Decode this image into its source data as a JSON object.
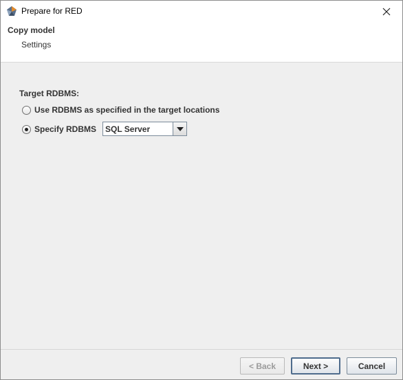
{
  "window": {
    "title": "Prepare for RED",
    "icons": {
      "app": "wherescape-app-icon",
      "close": "close-icon"
    }
  },
  "header": {
    "title": "Copy model",
    "subtitle": "Settings"
  },
  "content": {
    "section_label": "Target RDBMS:",
    "options": [
      {
        "label": "Use RDBMS as specified in the target locations",
        "checked": false
      },
      {
        "label": "Specify RDBMS",
        "checked": true
      }
    ],
    "rdbms_select": {
      "value": "SQL Server"
    }
  },
  "footer": {
    "back_label": "< Back",
    "next_label": "Next >",
    "cancel_label": "Cancel"
  },
  "colors": {
    "panel_background": "#efefef",
    "header_background": "#ffffff",
    "button_border": "#7a8a99",
    "default_button_border": "#4d6b8c"
  }
}
